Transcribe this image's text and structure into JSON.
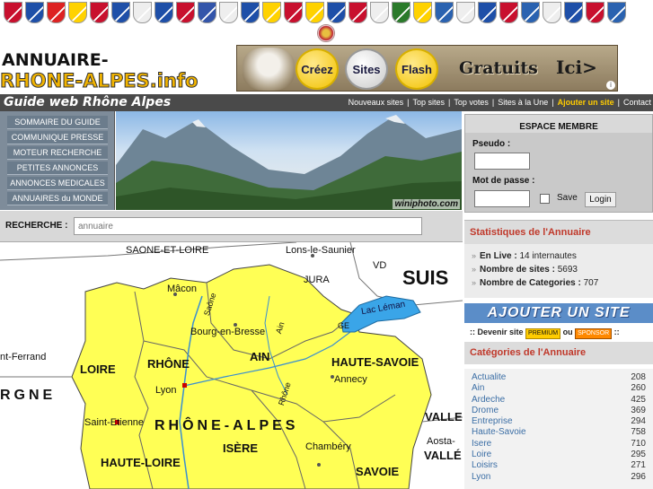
{
  "flags": [
    "#c8102e",
    "#1e4fa8",
    "#d22",
    "#ffd200",
    "#c8102e",
    "#1e4fa8",
    "#eeeeee",
    "#1e4fa8",
    "#c8102e",
    "#3355aa",
    "#eeeeee",
    "#1e4fa8",
    "#ffd200",
    "#c8102e",
    "#ffd200",
    "#1e4fa8",
    "#c8102e",
    "#eeeeee",
    "#2a7a2a",
    "#ffd200",
    "#2a62b0",
    "#eeeeee",
    "#1e4fa8",
    "#c8102e",
    "#2a62b0",
    "#eeeeee",
    "#1e4fa8",
    "#c8102e",
    "#2a62b0"
  ],
  "logo": {
    "line1": "ANNUAIRE-",
    "line2": "RHONE-ALPES.info"
  },
  "banner": {
    "btn1": "Créez",
    "btn2": "Sites",
    "btn3": "Flash",
    "gratuits": "Gratuits",
    "ici": "Ici>",
    "info": "i"
  },
  "navbar": {
    "tagline": "Guide web Rhône Alpes",
    "links": [
      "Nouveaux sites",
      "|",
      "Top sites",
      "|",
      "Top votes",
      "|",
      "Sites à la Une",
      "|",
      "Ajouter un site",
      "|",
      "Contact"
    ]
  },
  "menu": [
    "SOMMAIRE DU GUIDE",
    "COMMUNIQUE PRESSE",
    "MOTEUR RECHERCHE",
    "PETITES ANNONCES",
    "ANNONCES MEDICALES",
    "ANNUAIRES du MONDE"
  ],
  "photo": {
    "watermark": "winiphoto.com"
  },
  "search": {
    "label": "RECHERCHE :",
    "placeholder": "annuaire"
  },
  "map": {
    "labels": {
      "saone_loire": "SAONE-ET-LOIRE",
      "lons": "Lons-le-Saunier",
      "vd": "VD",
      "suis": "SUIS",
      "jura": "JURA",
      "macon": "Mâcon",
      "saone_river": "Saône",
      "bourg": "Bourg-en-Bresse",
      "ain_river": "Ain",
      "lac": "Lac Léman",
      "ge": "GE",
      "ferrand": "nt-Ferrand",
      "loire": "LOIRE",
      "rhone": "RHÔNE",
      "ain": "AIN",
      "haute_savoie": "HAUTE-SAVOIE",
      "annecy": "Annecy",
      "rgne": "RGNE",
      "lyon": "Lyon",
      "rhone_river": "Rhône",
      "valle": "VALLE",
      "st_etienne": "Saint-Etienne",
      "region": "RHÔNE-ALPES",
      "aosta": "Aosta-",
      "valle2": "VALLÉ",
      "isere": "ISÈRE",
      "chambery": "Chambéry",
      "haute_loire": "HAUTE-LOIRE",
      "savoie": "SAVOIE"
    }
  },
  "membre": {
    "title": "ESPACE MEMBRE",
    "pseudo_label": "Pseudo :",
    "pass_label": "Mot de passe :",
    "save_label": "Save",
    "login_label": "Login"
  },
  "stats": {
    "title": "Statistiques de l'Annuaire",
    "live_label": "En Live :",
    "live_value": "14 internautes",
    "sites_label": "Nombre de sites :",
    "sites_value": "5693",
    "cats_label": "Nombre de Categories :",
    "cats_value": "707"
  },
  "ajouter": "AJOUTER UN SITE",
  "devenir": {
    "prefix": ":: Devenir site",
    "premium": "PREMIUM",
    "ou": "ou",
    "sponsor": "SPONSOR",
    "suffix": "::"
  },
  "categories": {
    "title": "Catégories de l'Annuaire",
    "items": [
      {
        "name": "Actualite",
        "count": "208"
      },
      {
        "name": "Ain",
        "count": "260"
      },
      {
        "name": "Ardeche",
        "count": "425"
      },
      {
        "name": "Drome",
        "count": "369"
      },
      {
        "name": "Entreprise",
        "count": "294"
      },
      {
        "name": "Haute-Savoie",
        "count": "758"
      },
      {
        "name": "Isere",
        "count": "710"
      },
      {
        "name": "Loire",
        "count": "295"
      },
      {
        "name": "Loisirs",
        "count": "271"
      },
      {
        "name": "Lyon",
        "count": "296"
      }
    ]
  }
}
